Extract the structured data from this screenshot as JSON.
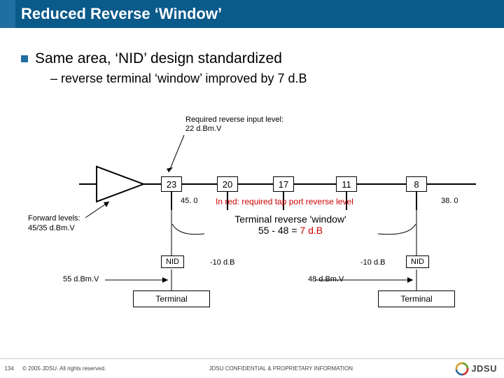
{
  "title": "Reduced Reverse ‘Window’",
  "bullet_main": "Same area, ‘NID’ design standardized",
  "bullet_sub": "– reverse terminal ‘window’ improved by 7 d.B",
  "required_label_l1": "Required reverse input level:",
  "required_label_l2": "22 d.Bm.V",
  "boxes": {
    "b1": "23",
    "b2": "20",
    "b3": "17",
    "b4": "11",
    "b5": "8"
  },
  "amp_out": "45. 0",
  "red_note": "In red: required tap port reverse level",
  "end_val": "38. 0",
  "forward_l1": "Forward levels:",
  "forward_l2": "45/35 d.Bm.V",
  "window_l1": "Terminal reverse 'window'",
  "window_l2_a": "55 - 48 = ",
  "window_l2_b": "7 d.B",
  "nid": "NID",
  "minus10": "-10 d.B",
  "lvl_left": "55 d.Bm.V",
  "lvl_right": "48 d.Bm.V",
  "terminal": "Terminal",
  "footer": {
    "page": "134",
    "copyright": "© 2005 JDSU. All rights reserved.",
    "conf": "JDSU CONFIDENTIAL & PROPRIETARY INFORMATION",
    "brand": "JDSU"
  }
}
